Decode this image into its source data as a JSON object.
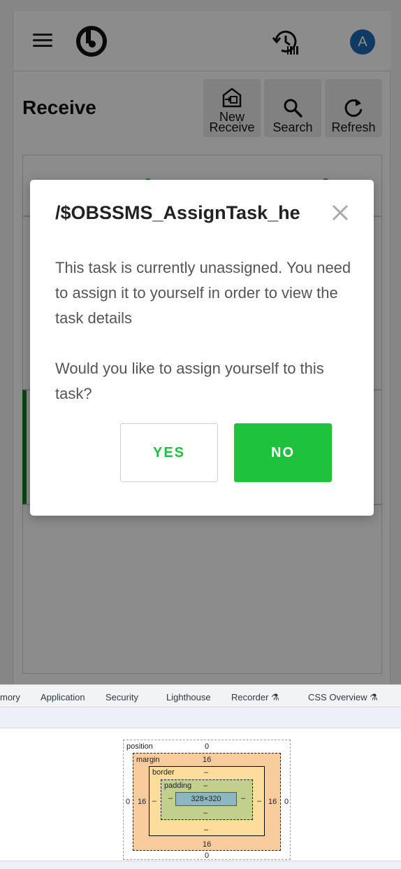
{
  "header": {
    "avatar_initial": "A"
  },
  "page": {
    "title": "Receive",
    "buttons": {
      "new_receive_line1": "New",
      "new_receive_line2": "Receive",
      "search": "Search",
      "refresh": "Refresh"
    }
  },
  "modal": {
    "title": "/$OBSSMS_AssignTask_he",
    "message": "This task is currently unassigned. You need to assign it to yourself in order to view the task details",
    "question": "Would you like to assign yourself to this task?",
    "yes_label": "YES",
    "no_label": "NO"
  },
  "colors": {
    "accent_green": "#1fc23c",
    "avatar_blue": "#1a6bb5"
  },
  "devtools": {
    "tabs": [
      "mory",
      "Application",
      "Security",
      "Lighthouse",
      "Recorder",
      "CSS Overview"
    ],
    "box_model": {
      "position_label": "position",
      "position_top": "0",
      "position_left": "0",
      "position_right": "0",
      "position_bottom": "0",
      "margin_label": "margin",
      "margin_top": "16",
      "margin_left": "16",
      "margin_right": "16",
      "margin_bottom": "16",
      "border_label": "border",
      "border_top": "–",
      "border_left": "–",
      "border_right": "–",
      "border_bottom": "–",
      "padding_label": "padding",
      "padding_top": "–",
      "padding_left": "–",
      "padding_right": "–",
      "padding_bottom": "–",
      "content_size": "328×320"
    }
  }
}
